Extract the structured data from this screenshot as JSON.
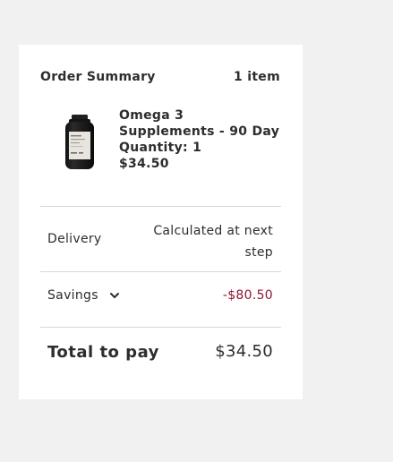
{
  "summary": {
    "title": "Order Summary",
    "item_count": "1 item"
  },
  "product": {
    "image_icon": "supplement-bottle-icon",
    "name": "Omega 3 Supplements - 90 Day",
    "quantity": "Quantity: 1",
    "price": "$34.50"
  },
  "delivery": {
    "label": "Delivery",
    "value": "Calculated at next step"
  },
  "savings": {
    "label": "Savings",
    "icon": "chevron-down-icon",
    "value": "-$80.50",
    "value_color": "#8f1730"
  },
  "total": {
    "label": "Total to pay",
    "value": "$34.50"
  }
}
